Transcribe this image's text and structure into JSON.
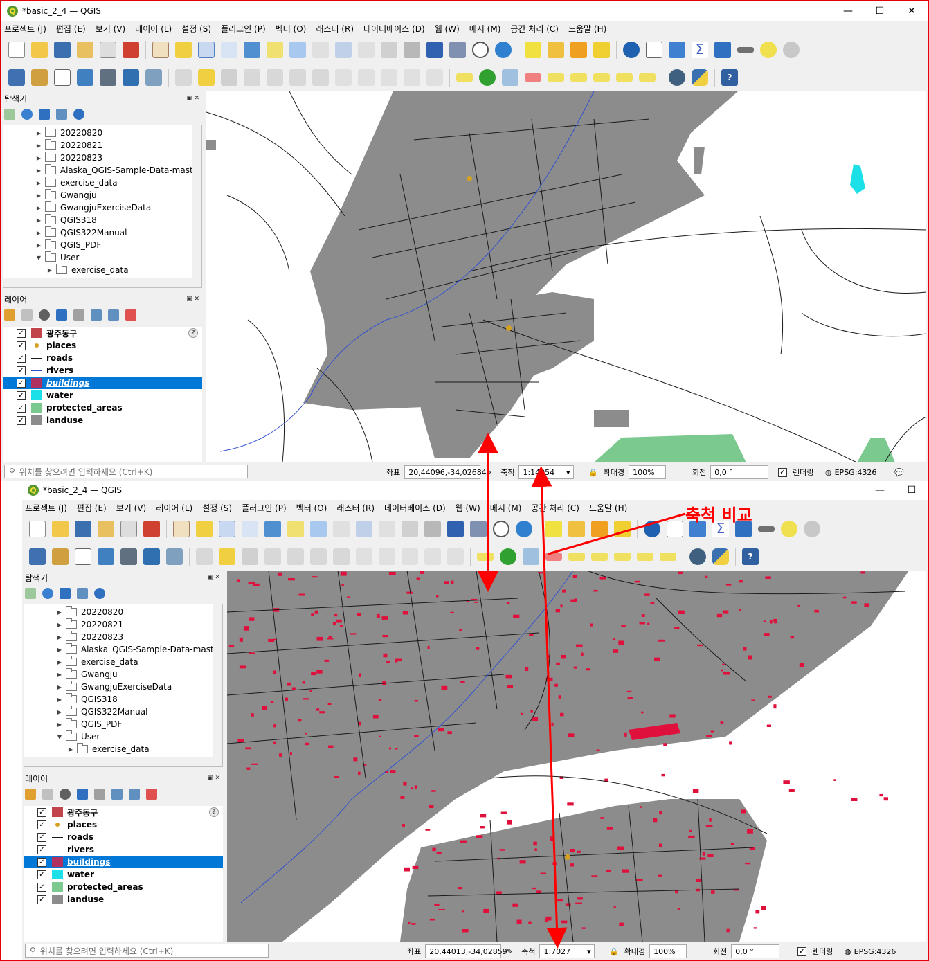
{
  "annotation": {
    "label": "축척 비교",
    "color": "#ff0000"
  },
  "top": {
    "title": "*basic_2_4 — QGIS",
    "menu": [
      "프로젝트 (J)",
      "편집 (E)",
      "보기 (V)",
      "레이어 (L)",
      "설정 (S)",
      "플러그인 (P)",
      "벡터 (O)",
      "래스터 (R)",
      "데이터베이스 (D)",
      "웹 (W)",
      "메시 (M)",
      "공간 처리 (C)",
      "도움말 (H)"
    ],
    "browser_title": "탐색기",
    "browser_items": [
      "20220820",
      "20220821",
      "20220823",
      "Alaska_QGIS-Sample-Data-master",
      "exercise_data",
      "Gwangju",
      "GwangjuExerciseData",
      "QGIS318",
      "QGIS322Manual",
      "QGIS_PDF",
      "User",
      "exercise_data"
    ],
    "layers_title": "레이어",
    "layers": [
      "광주동구",
      "places",
      "roads",
      "rivers",
      "buildings",
      "water",
      "protected_areas",
      "landuse"
    ],
    "locator_placeholder": "위치를 찾으려면 입력하세요 (Ctrl+K)",
    "coord_label": "좌표",
    "coord_value": "20,44096,-34,02684",
    "scale_label": "축척",
    "scale_value": "1:14054",
    "magnifier_label": "확대경",
    "magnifier_value": "100%",
    "rotation_label": "회전",
    "rotation_value": "0,0 °",
    "render_label": "렌더링",
    "crs": "EPSG:4326"
  },
  "bottom": {
    "title": "*basic_2_4 — QGIS",
    "menu": [
      "프로젝트 (J)",
      "편집 (E)",
      "보기 (V)",
      "레이어 (L)",
      "설정 (S)",
      "플러그인 (P)",
      "벡터 (O)",
      "래스터 (R)",
      "데이터베이스 (D)",
      "웹 (W)",
      "메시 (M)",
      "공간 처리 (C)",
      "도움말 (H)"
    ],
    "browser_title": "탐색기",
    "browser_items": [
      "20220820",
      "20220821",
      "20220823",
      "Alaska_QGIS-Sample-Data-master",
      "exercise_data",
      "Gwangju",
      "GwangjuExerciseData",
      "QGIS318",
      "QGIS322Manual",
      "QGIS_PDF",
      "User",
      "exercise_data"
    ],
    "layers_title": "레이어",
    "layers": [
      "광주동구",
      "places",
      "roads",
      "rivers",
      "buildings",
      "water",
      "protected_areas",
      "landuse"
    ],
    "locator_placeholder": "위치를 찾으려면 입력하세요 (Ctrl+K)",
    "coord_label": "좌표",
    "coord_value": "20,44013,-34,02859",
    "scale_label": "축척",
    "scale_value": "1:7027",
    "magnifier_label": "확대경",
    "magnifier_value": "100%",
    "rotation_label": "회전",
    "rotation_value": "0,0 °",
    "render_label": "렌더링",
    "crs": "EPSG:4326"
  },
  "layer_colors": {
    "광주동구": "#c0444a",
    "places": "#d4a020",
    "roads": "#1a1a1a",
    "rivers": "#3050d0",
    "buildings": "#e0103c",
    "water": "#1ce0e8",
    "protected_areas": "#7bc98e",
    "landuse": "#8c8c8c"
  },
  "icons": [
    "new-project-icon",
    "open-icon",
    "save-icon",
    "pan-icon",
    "zoom-in-icon",
    "zoom-out-icon",
    "identify-icon",
    "python-icon",
    "help-icon"
  ]
}
